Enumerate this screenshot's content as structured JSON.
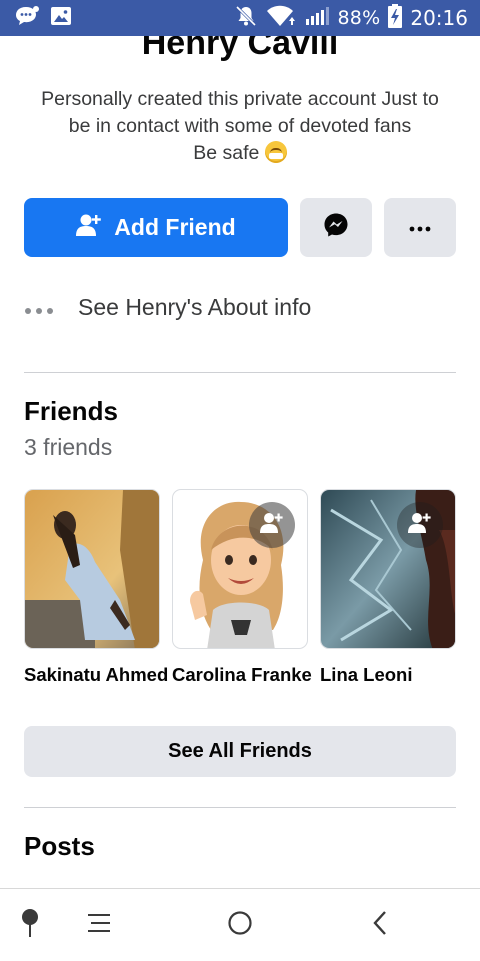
{
  "status_bar": {
    "battery": "88%",
    "time": "20:16"
  },
  "profile": {
    "name": "Henry Cavill",
    "bio_line1": "Personally created this private account Just to",
    "bio_line2": "be in contact with some of devoted fans",
    "bio_line3": "Be safe"
  },
  "actions": {
    "add_friend_label": "Add Friend"
  },
  "about": {
    "label": "See Henry's About info"
  },
  "friends": {
    "title": "Friends",
    "count_text": "3 friends",
    "items": [
      {
        "name": "Sakinatu Ahmed"
      },
      {
        "name": "Carolina Franke"
      },
      {
        "name": "Lina Leoni"
      }
    ],
    "see_all_label": "See All Friends"
  },
  "posts": {
    "title": "Posts"
  },
  "colors": {
    "status_bar": "#3b5aa6",
    "primary": "#1877f2",
    "secondary_button": "#e4e6eb"
  }
}
